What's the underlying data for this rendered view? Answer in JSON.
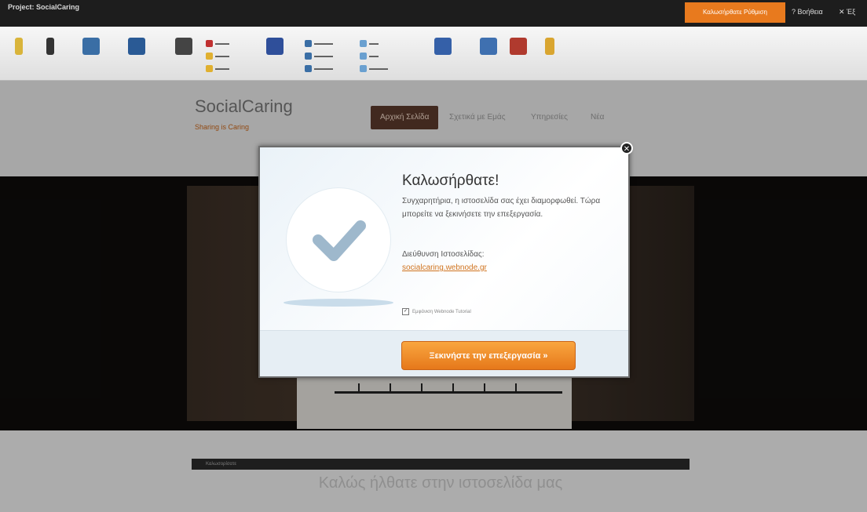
{
  "titlebar": {
    "app_title": "Project: SocialCaring",
    "welcome_button": "Καλωσήρθατε Ρύθμιση",
    "help": "? Βοήθεια",
    "exit": "✕ Έξ"
  },
  "site": {
    "logo": "SocialCaring",
    "slogan": "Sharing is Caring",
    "nav": [
      "Αρχική Σελίδα",
      "Σχετικά με Εμάς",
      "Υπηρεσίες",
      "Νέα"
    ],
    "content_bar": "Καλωσορίσατε",
    "content_welcome": "Καλώς ήλθατε στην ιστοσελίδα μας"
  },
  "modal": {
    "title": "Καλωσήρθατε!",
    "text": "Συγχαρητήρια, η ιστοσελίδα σας έχει διαμορφωθεί. Τώρα μπορείτε να ξεκινήσετε την επεξεργασία.",
    "address_label": "Διεύθυνση Ιστοσελίδας:",
    "address_link": "socialcaring.webnode.gr",
    "tutorial_checkbox": "Εμφάνιση Webnode Tutorial",
    "start_button": "Ξεκινήστε την επεξεργασία »",
    "close_icon": "close-icon"
  },
  "colors": {
    "accent": "#e87a1e",
    "nav_active": "#5a3a2c",
    "link": "#d0731e",
    "check": "#9eb8cc"
  }
}
